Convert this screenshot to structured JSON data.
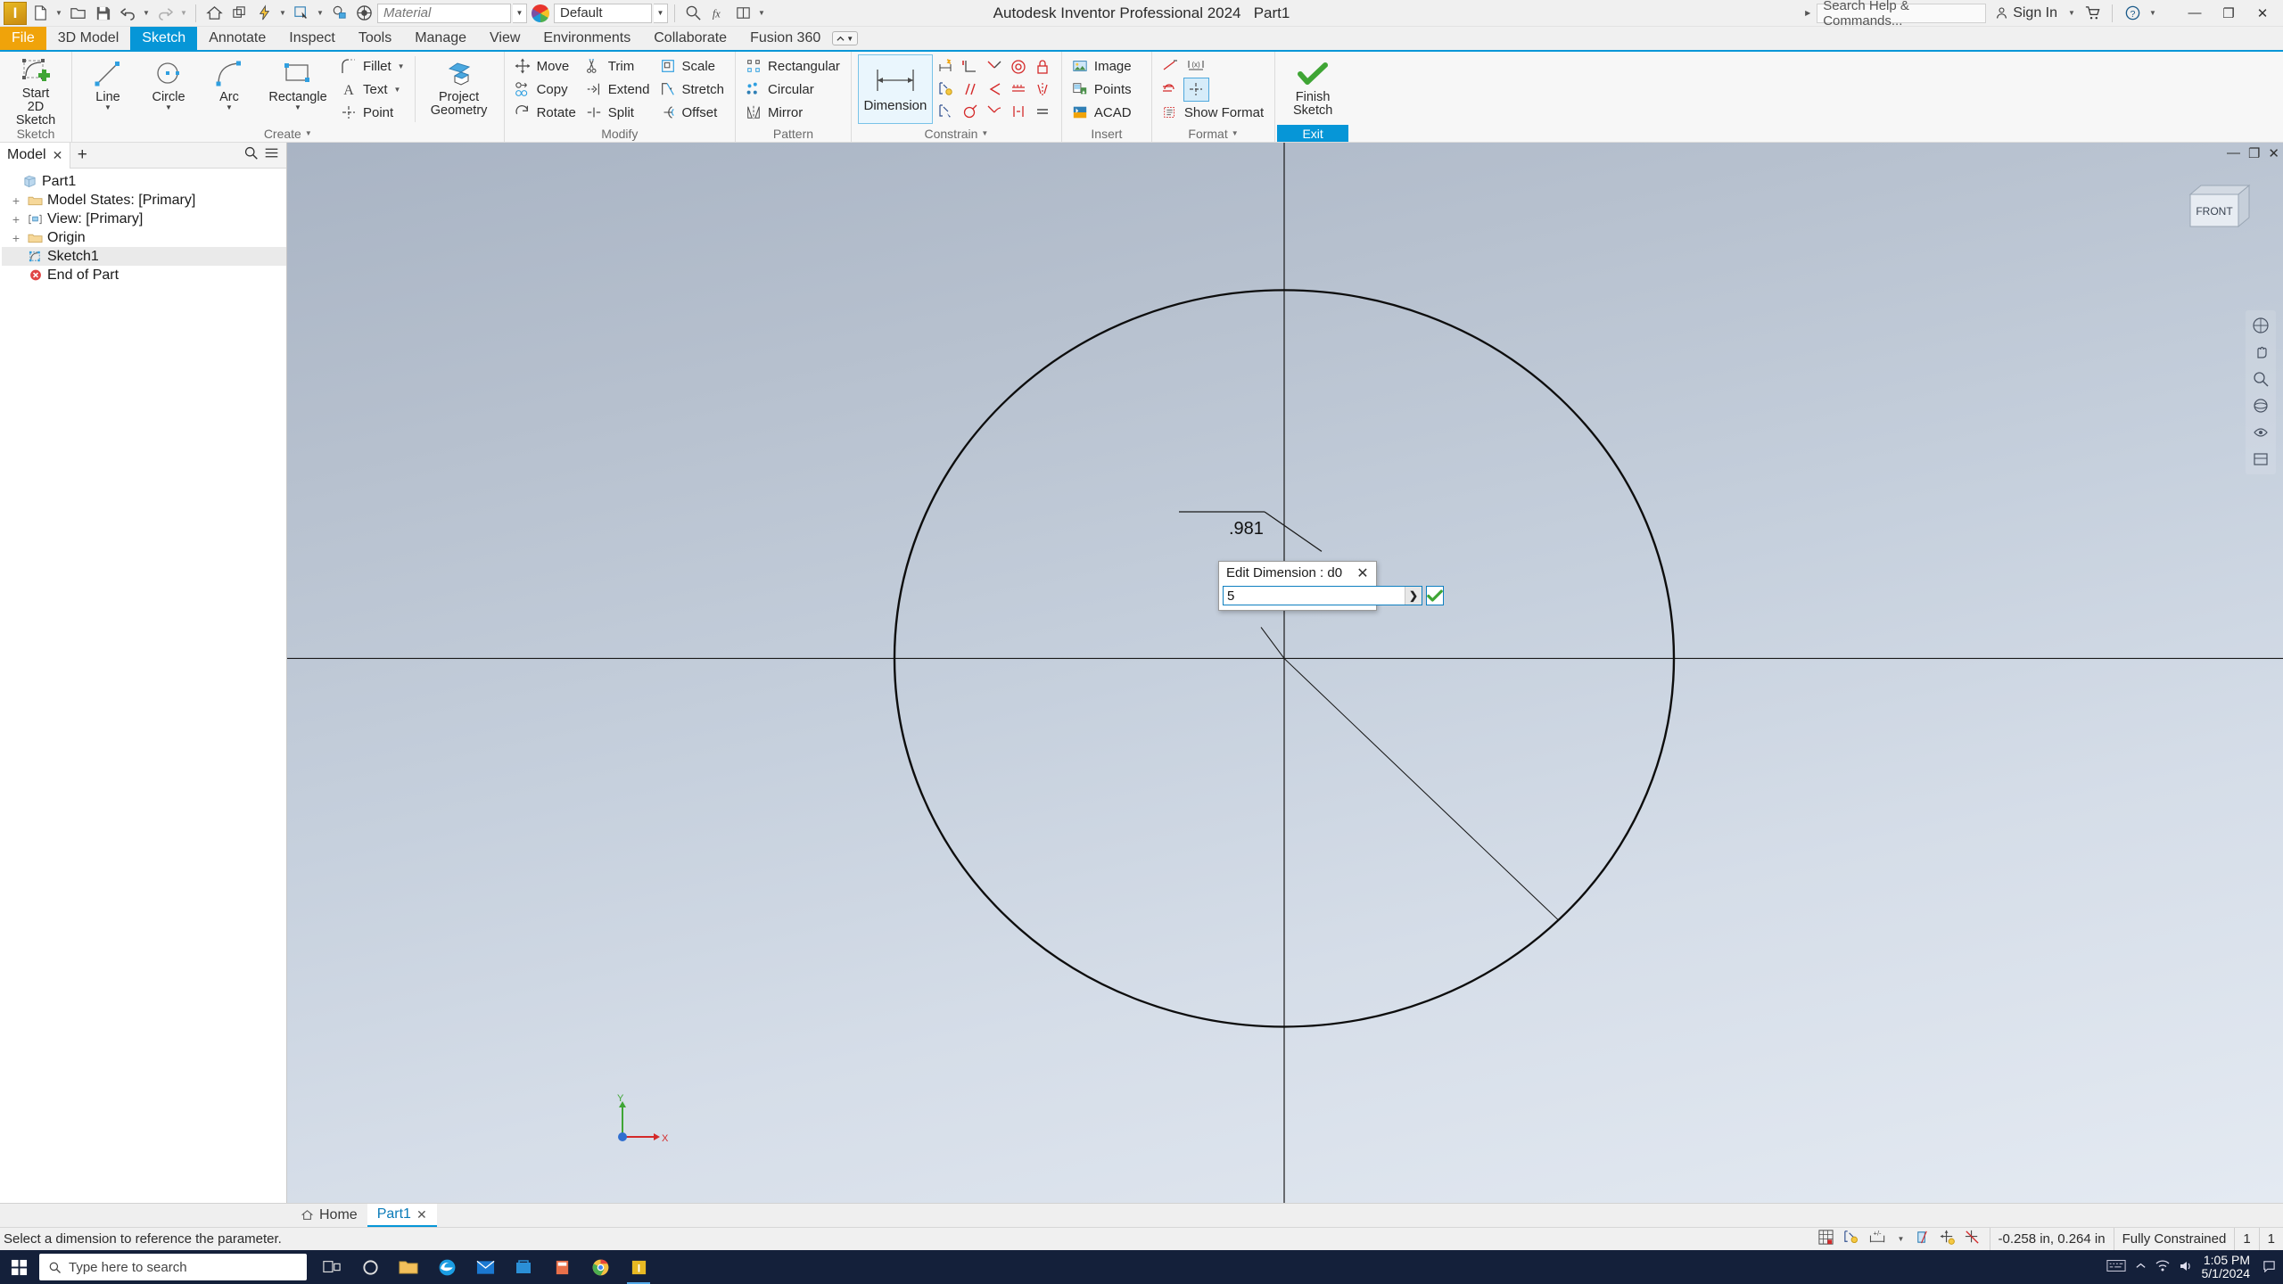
{
  "titlebar": {
    "app_title": "Autodesk Inventor Professional 2024",
    "document_name": "Part1",
    "material_value": "Material",
    "appearance_value": "Default",
    "search_placeholder": "Search Help & Commands...",
    "sign_in": "Sign In",
    "quick_access": [
      {
        "name": "new-file-icon",
        "label": "New"
      },
      {
        "name": "open-file-icon",
        "label": "Open"
      },
      {
        "name": "save-icon",
        "label": "Save"
      },
      {
        "name": "undo-icon",
        "label": "Undo"
      },
      {
        "name": "redo-icon",
        "label": "Redo"
      },
      {
        "name": "home-icon",
        "label": "Home"
      },
      {
        "name": "return-icon",
        "label": "Return"
      },
      {
        "name": "update-icon",
        "label": "Update"
      },
      {
        "name": "select-icon",
        "label": "Select"
      },
      {
        "name": "appearance-icon",
        "label": "Appearance"
      }
    ],
    "window_buttons": [
      "minimize",
      "restore",
      "close"
    ]
  },
  "ribbon": {
    "tabs": [
      {
        "label": "File",
        "state": "file"
      },
      {
        "label": "3D Model",
        "state": "normal"
      },
      {
        "label": "Sketch",
        "state": "active"
      },
      {
        "label": "Annotate",
        "state": "normal"
      },
      {
        "label": "Inspect",
        "state": "normal"
      },
      {
        "label": "Tools",
        "state": "normal"
      },
      {
        "label": "Manage",
        "state": "normal"
      },
      {
        "label": "View",
        "state": "normal"
      },
      {
        "label": "Environments",
        "state": "normal"
      },
      {
        "label": "Collaborate",
        "state": "normal"
      },
      {
        "label": "Fusion 360",
        "state": "normal"
      }
    ],
    "panels": [
      {
        "name": "sketch",
        "label": "Sketch",
        "big_buttons": [
          {
            "label1": "Start",
            "label2": "2D Sketch",
            "icon": "start-2d-sketch-icon",
            "dropdown": true
          }
        ]
      },
      {
        "name": "create",
        "label": "Create",
        "has_dropdown": true,
        "big_buttons": [
          {
            "label1": "Line",
            "label2": "",
            "icon": "line-icon",
            "dropdown": true
          },
          {
            "label1": "Circle",
            "label2": "",
            "icon": "circle-icon",
            "dropdown": true
          },
          {
            "label1": "Arc",
            "label2": "",
            "icon": "arc-icon",
            "dropdown": true
          },
          {
            "label1": "Rectangle",
            "label2": "",
            "icon": "rectangle-icon",
            "dropdown": true
          }
        ],
        "small_buttons": [
          {
            "label": "Fillet",
            "icon": "fillet-icon",
            "dropdown": true
          },
          {
            "label": "Text",
            "icon": "text-icon",
            "dropdown": true
          },
          {
            "label": "Point",
            "icon": "point-icon",
            "dropdown": false
          }
        ],
        "project_button": {
          "label1": "Project",
          "label2": "Geometry",
          "icon": "project-geometry-icon",
          "dropdown": true
        }
      },
      {
        "name": "modify",
        "label": "Modify",
        "columns": [
          [
            {
              "label": "Move",
              "icon": "move-icon"
            },
            {
              "label": "Copy",
              "icon": "copy-icon"
            },
            {
              "label": "Rotate",
              "icon": "rotate-icon"
            }
          ],
          [
            {
              "label": "Trim",
              "icon": "trim-icon"
            },
            {
              "label": "Extend",
              "icon": "extend-icon"
            },
            {
              "label": "Split",
              "icon": "split-icon"
            }
          ],
          [
            {
              "label": "Scale",
              "icon": "scale-icon"
            },
            {
              "label": "Stretch",
              "icon": "stretch-icon"
            },
            {
              "label": "Offset",
              "icon": "offset-icon"
            }
          ]
        ]
      },
      {
        "name": "pattern",
        "label": "Pattern",
        "columns": [
          [
            {
              "label": "Rectangular",
              "icon": "rectangular-pattern-icon"
            },
            {
              "label": "Circular",
              "icon": "circular-pattern-icon"
            },
            {
              "label": "Mirror",
              "icon": "mirror-icon"
            }
          ]
        ]
      },
      {
        "name": "constrain",
        "label": "Constrain",
        "has_dropdown": true,
        "dimension_button": {
          "label": "Dimension",
          "icon": "dimension-icon",
          "selected": true
        },
        "icons": [
          "auto-dimension-icon",
          "perpendicular-constraint-icon",
          "tangent-constraint-icon",
          "concentric-constraint-icon",
          "fix-constraint-icon",
          "show-constraints-icon",
          "parallel-constraint-icon",
          "coincident-constraint-icon",
          "collinear-constraint-icon",
          "symmetric-constraint-icon",
          "constraint-settings-icon",
          "equal-radius-icon",
          "smooth-constraint-icon",
          "horizontal-constraint-icon",
          "equal-constraint-icon"
        ]
      },
      {
        "name": "insert",
        "label": "Insert",
        "columns": [
          [
            {
              "label": "Image",
              "icon": "image-icon"
            },
            {
              "label": "Points",
              "icon": "points-icon"
            },
            {
              "label": "ACAD",
              "icon": "acad-icon"
            }
          ]
        ]
      },
      {
        "name": "format",
        "label": "Format",
        "has_dropdown": true,
        "icons": [
          "construction-line-icon",
          "driven-dimension-icon",
          "centerline-icon",
          "center-point-icon"
        ],
        "small_buttons": [
          {
            "label": "Show Format",
            "icon": "show-format-icon"
          }
        ]
      },
      {
        "name": "exit",
        "label": "Exit",
        "big_buttons": [
          {
            "label1": "Finish",
            "label2": "Sketch",
            "icon": "finish-sketch-icon",
            "dropdown": false
          }
        ]
      }
    ]
  },
  "browser": {
    "tab_label": "Model",
    "tab_close": "✕",
    "add_tab": "+",
    "search_icon": "search-icon",
    "menu_icon": "hamburger-menu-icon",
    "tree": [
      {
        "label": "Part1",
        "icon": "part-icon",
        "indent": 0,
        "expander": "",
        "selected": false
      },
      {
        "label": "Model States: [Primary]",
        "icon": "folder-icon",
        "indent": 1,
        "expander": "+",
        "selected": false
      },
      {
        "label": "View: [Primary]",
        "icon": "view-icon",
        "indent": 1,
        "expander": "+",
        "selected": false
      },
      {
        "label": "Origin",
        "icon": "folder-icon",
        "indent": 1,
        "expander": "+",
        "selected": false
      },
      {
        "label": "Sketch1",
        "icon": "sketch-icon",
        "indent": 1,
        "expander": "",
        "selected": true
      },
      {
        "label": "End of Part",
        "icon": "end-of-part-icon",
        "indent": 1,
        "expander": "",
        "selected": false
      }
    ]
  },
  "canvas": {
    "view_cube_label": "FRONT",
    "dimension_text": ".981",
    "origin_axis": {
      "x_label": "X",
      "y_label": "Y"
    }
  },
  "dialog": {
    "title": "Edit Dimension : d0",
    "close_label": "✕",
    "value": "5",
    "arrow_label": "❯",
    "accept_icon": "green-check-icon"
  },
  "doctabs": [
    {
      "label": "Home",
      "icon": "home-icon",
      "active": false,
      "closable": false
    },
    {
      "label": "Part1",
      "icon": "",
      "active": true,
      "closable": true
    }
  ],
  "statusbar": {
    "message": "Select a dimension to reference the parameter.",
    "tools": [
      "sketch-grid-icon",
      "constraint-visibility-icon",
      "dimension-visibility-icon",
      "slice-graphics-icon",
      "dof-icon",
      "dof-symbol-icon"
    ],
    "coordinates": "-0.258 in, 0.264 in",
    "constraint_status": "Fully Constrained",
    "field_1": "1",
    "field_2": "1"
  },
  "taskbar": {
    "search_placeholder": "Type here to search",
    "start_icon": "windows-start-icon",
    "apps": [
      {
        "name": "taskview-icon"
      },
      {
        "name": "folder-explorer-icon"
      },
      {
        "name": "edge-icon"
      },
      {
        "name": "mail-icon"
      },
      {
        "name": "store-icon"
      },
      {
        "name": "calculator-icon"
      },
      {
        "name": "chrome-icon"
      },
      {
        "name": "inventor-taskbar-icon"
      }
    ],
    "tray": [
      "keyboard-icon",
      "chevron-up-icon",
      "network-icon",
      "volume-icon"
    ],
    "time": "1:05 PM",
    "date": "5/1/2024",
    "notification_icon": "notification-icon"
  },
  "colors": {
    "accent": "#0696d7",
    "file_tab": "#f0a30a",
    "taskbar": "#14203a",
    "selection": "#eaeaea"
  }
}
